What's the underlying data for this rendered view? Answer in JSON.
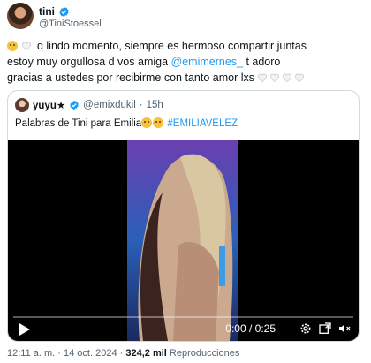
{
  "author": {
    "name": "tini",
    "handle": "@TiniStoessel"
  },
  "tweet": {
    "line1_text": "q lindo momento, siempre es hermoso compartir juntas",
    "line2_before": "estoy muy orgullosa d vos amiga ",
    "line2_mention": "@emimernes_",
    "line2_after": " t adoro",
    "line3_text": "gracias a ustedes por recibirme con tanto amor lxs"
  },
  "quoted": {
    "name": "yuyu★",
    "handle": "@emixdukil",
    "separator": "·",
    "time": "15h",
    "text_before": "Palabras de Tini para Emilia",
    "text_after": "#EMILIAVELEZ"
  },
  "video": {
    "time_display": "0:00 / 0:25",
    "progress": 0
  },
  "meta": {
    "time": "12:11 a. m.",
    "date": "14 oct. 2024",
    "dot": "·",
    "views": "324,2 mil",
    "views_label": "Reproducciones"
  },
  "colors": {
    "accent": "#1d9bf0",
    "text": "#0f1419",
    "muted": "#536471",
    "border": "#cfd9de"
  },
  "icons": [
    "verified-badge-icon",
    "crying-face-emoji",
    "white-heart-emoji",
    "play-icon",
    "settings-icon",
    "fullscreen-icon",
    "expand-icon",
    "mute-icon"
  ]
}
